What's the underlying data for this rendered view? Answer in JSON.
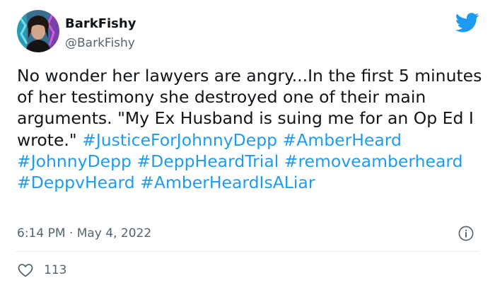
{
  "author": {
    "display_name": "BarkFishy",
    "handle": "@BarkFishy"
  },
  "tweet": {
    "text_parts": [
      "No wonder her lawyers are angry...In the first 5 minutes of her testimony she destroyed one of their main arguments. \"My Ex Husband is suing me for an Op Ed I wrote.\"  "
    ],
    "hashtags": [
      "#JusticeForJohnnyDepp",
      "#AmberHeard",
      "#JohnnyDepp",
      "#DeppHeardTrial",
      "#removeamberheard",
      "#DeppvHeard",
      "#AmberHeardIsALiar"
    ],
    "timestamp": "6:14 PM · May 4, 2022",
    "like_count": "113"
  },
  "icons": {
    "brand": "twitter-bird-icon",
    "info": "info-icon",
    "like": "heart-icon"
  },
  "colors": {
    "link": "#1d9bf0",
    "text": "#0f1419",
    "muted": "#536471",
    "divider": "#e6ecf0"
  }
}
